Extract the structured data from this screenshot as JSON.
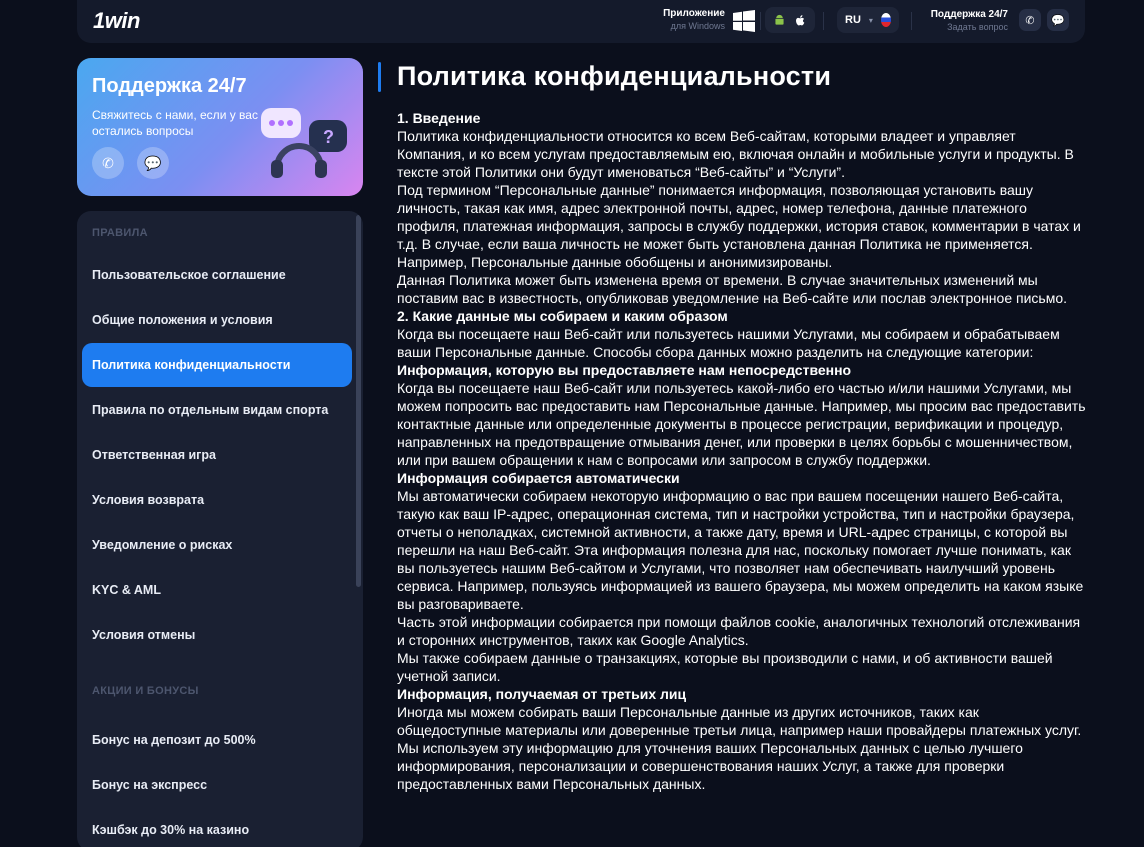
{
  "header": {
    "logo": "1win",
    "app_title": "Приложение",
    "app_subtitle": "для Windows",
    "language": "RU",
    "support_title": "Поддержка 24/7",
    "support_subtitle": "Задать вопрос"
  },
  "support_card": {
    "title": "Поддержка 24/7",
    "description": "Свяжитесь с нами, если у вас остались вопросы"
  },
  "sidebar": {
    "section_rules": "ПРАВИЛА",
    "rules": [
      "Пользовательское соглашение",
      "Общие положения и условия",
      "Политика конфиденциальности",
      "Правила по отдельным видам спорта",
      "Ответственная игра",
      "Условия возврата",
      "Уведомление о рисках",
      "KYC & AML",
      "Условия отмены"
    ],
    "section_promo": "АКЦИИ И БОНУСЫ",
    "promos": [
      "Бонус на депозит до 500%",
      "Бонус на экспресс",
      "Кэшбэк до 30% на казино"
    ]
  },
  "content": {
    "title": "Политика конфиденциальности",
    "blocks": [
      {
        "h": "1. Введение"
      },
      {
        "p": "Политика конфиденциальности относится ко всем Веб-сайтам, которыми владеет и управляет Компания, и ко всем услугам предоставляемым ею, включая онлайн и мобильные услуги и продукты. В тексте этой Политики они будут именоваться “Веб-сайты” и “Услуги”."
      },
      {
        "p": "Под термином “Персональные данные” понимается информация, позволяющая установить вашу личность, такая как имя, адрес электронной почты, адрес, номер телефона, данные платежного профиля, платежная информация, запросы в службу поддержки, история ставок, комментарии в чатах и т.д. В случае, если ваша личность не может быть установлена данная Политика не применяется. Например, Персональные данные обобщены и анонимизированы."
      },
      {
        "p": "Данная Политика может быть изменена время от времени. В случае значительных изменений мы поставим вас в известность, опубликовав уведомление на Веб-сайте или послав электронное письмо."
      },
      {
        "h": "2. Какие данные мы собираем и каким образом"
      },
      {
        "p": "Когда вы посещаете наш Веб-сайт или пользуетесь нашими Услугами, мы собираем и обрабатываем ваши Персональные данные. Способы сбора данных можно разделить на следующие категории:"
      },
      {
        "h": "Информация, которую вы предоставляете нам непосредственно"
      },
      {
        "p": "Когда вы посещаете наш Веб-сайт или пользуетесь какой-либо его частью и/или нашими Услугами, мы можем попросить вас предоставить нам Персональные данные. Например, мы просим вас предоставить контактные данные или определенные документы в процессе регистрации, верификации и процедур, направленных на предотвращение отмывания денег, или проверки в целях борьбы с мошенничеством, или при вашем обращении к нам с вопросами или запросом в службу поддержки."
      },
      {
        "h": "Информация собирается автоматически"
      },
      {
        "p": "Мы автоматически собираем некоторую информацию о вас при вашем посещении нашего Веб-сайта, такую как ваш IP-адрес, операционная система, тип и настройки устройства, тип и настройки браузера, отчеты о неполадках, системной активности, а также дату, время и URL-адрес страницы, с которой вы перешли на наш Веб-сайт. Эта информация полезна для нас, поскольку помогает лучше понимать, как вы пользуетесь нашим Веб-сайтом и Услугами, что позволяет нам обеспечивать наилучший уровень сервиса. Например, пользуясь информацией из вашего браузера, мы можем определить на каком языке вы разговариваете."
      },
      {
        "p": "Часть этой информации собирается при помощи файлов cookie, аналогичных технологий отслеживания и сторонних инструментов, таких как Google Analytics."
      },
      {
        "p": "Мы также собираем данные о транзакциях, которые вы производили с нами, и об активности вашей учетной записи."
      },
      {
        "h": "Информация, получаемая от третьих лиц"
      },
      {
        "p": "Иногда мы можем собирать ваши Персональные данные из других источников, таких как общедоступные материалы или доверенные третьи лица, например наши провайдеры платежных услуг. Мы используем эту информацию для уточнения ваших Персональных данных с целью лучшего информирования, персонализации и совершенствования наших Услуг, а также для проверки предоставленных вами Персональных данных."
      }
    ]
  }
}
